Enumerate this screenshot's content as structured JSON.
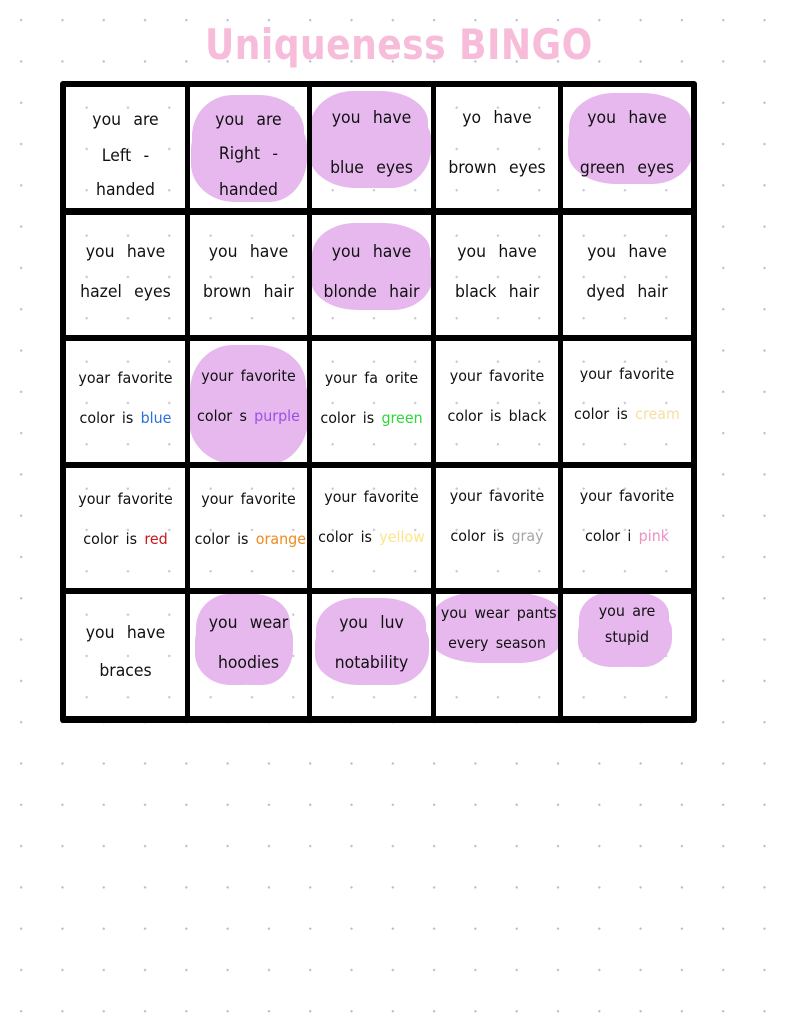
{
  "title": "Uniqueness BINGO",
  "highlight_color": "#e6b8ee",
  "title_color": "#f7bcd9",
  "board": {
    "rows": [
      [
        {
          "lines": [
            "you are",
            "Left -",
            "handed"
          ],
          "marked": false
        },
        {
          "lines": [
            "you are",
            "Right -",
            "handed"
          ],
          "marked": true
        },
        {
          "lines": [
            "you have",
            "blue eyes"
          ],
          "marked": true
        },
        {
          "lines": [
            "yo have",
            "brown eyes"
          ],
          "marked": false
        },
        {
          "lines": [
            "you have",
            "green eyes"
          ],
          "marked": true
        }
      ],
      [
        {
          "lines": [
            "you have",
            "hazel eyes"
          ],
          "marked": false
        },
        {
          "lines": [
            "you have",
            "brown hair"
          ],
          "marked": false
        },
        {
          "lines": [
            "you have",
            "blonde hair"
          ],
          "marked": true
        },
        {
          "lines": [
            "you have",
            "black hair"
          ],
          "marked": false
        },
        {
          "lines": [
            "you have",
            "dyed hair"
          ],
          "marked": false
        }
      ],
      [
        {
          "lines": [
            "yoar favorite",
            "color is"
          ],
          "color_word": "blue",
          "color_hex": "#2a6fdc",
          "marked": false
        },
        {
          "lines": [
            "your favorite",
            "color s"
          ],
          "color_word": "purple",
          "color_hex": "#9a4fe8",
          "marked": true
        },
        {
          "lines": [
            "your fa orite",
            "color is"
          ],
          "color_word": "green",
          "color_hex": "#2fd63a",
          "marked": false
        },
        {
          "lines": [
            "your favorite",
            "color is black"
          ],
          "marked": false
        },
        {
          "lines": [
            "your favorite",
            "color is"
          ],
          "color_word": "cream",
          "color_hex": "#f7dea0",
          "marked": false
        }
      ],
      [
        {
          "lines": [
            "your favorite",
            "color is"
          ],
          "color_word": "red",
          "color_hex": "#c8161b",
          "marked": false
        },
        {
          "lines": [
            "your favorite",
            "color is"
          ],
          "color_word": "orange",
          "color_hex": "#f08a1c",
          "marked": false
        },
        {
          "lines": [
            "your favorite",
            "color is"
          ],
          "color_word": "yellow",
          "color_hex": "#fbe58c",
          "marked": false
        },
        {
          "lines": [
            "your favorite",
            "color is"
          ],
          "color_word": "gray",
          "color_hex": "#a6a6a6",
          "marked": false
        },
        {
          "lines": [
            "your favorite",
            "color i"
          ],
          "color_word": "pink",
          "color_hex": "#f08fc0",
          "marked": false
        }
      ],
      [
        {
          "lines": [
            "you have",
            "braces"
          ],
          "marked": false
        },
        {
          "lines": [
            "you wear",
            "hoodies"
          ],
          "marked": true
        },
        {
          "lines": [
            "you luv",
            "notability"
          ],
          "marked": true
        },
        {
          "lines": [
            "you wear pants",
            "every season"
          ],
          "marked": true
        },
        {
          "lines": [
            "you are",
            "stupid"
          ],
          "marked": true
        }
      ]
    ]
  }
}
